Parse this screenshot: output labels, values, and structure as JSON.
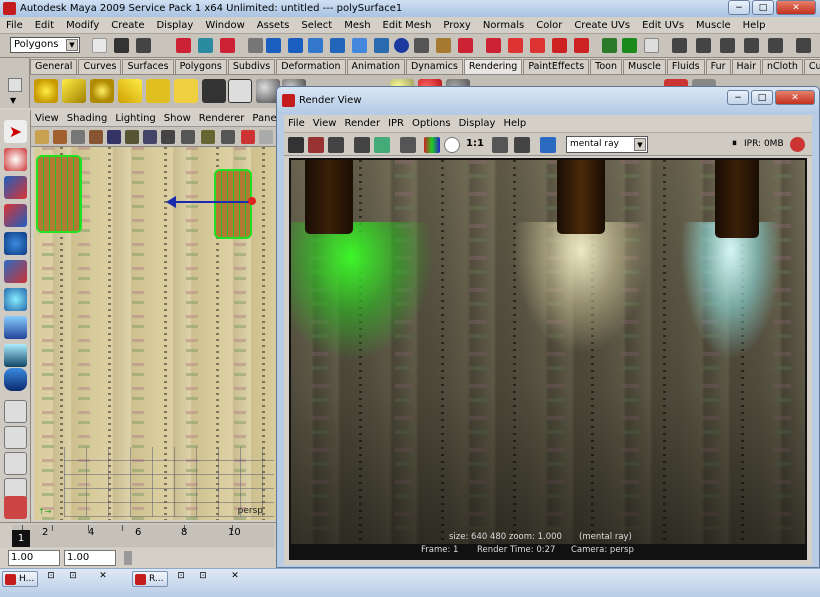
{
  "window": {
    "title": "Autodesk Maya 2009 Service Pack 1 x64 Unlimited: untitled   ---   polySurface1",
    "btn_min": "−",
    "btn_max": "□",
    "btn_close": "✕"
  },
  "menubar": [
    "File",
    "Edit",
    "Modify",
    "Create",
    "Display",
    "Window",
    "Assets",
    "Select",
    "Mesh",
    "Edit Mesh",
    "Proxy",
    "Normals",
    "Color",
    "Create UVs",
    "Edit UVs",
    "Muscle",
    "Help"
  ],
  "statusline": {
    "menu_set": "Polygons"
  },
  "shelf_tabs": [
    "General",
    "Curves",
    "Surfaces",
    "Polygons",
    "Subdivs",
    "Deformation",
    "Animation",
    "Dynamics",
    "Rendering",
    "PaintEffects",
    "Toon",
    "Muscle",
    "Fluids",
    "Fur",
    "Hair",
    "nCloth",
    "Custom"
  ],
  "shelf_active": "Rendering",
  "viewport": {
    "menu": [
      "View",
      "Shading",
      "Lighting",
      "Show",
      "Renderer",
      "Panels"
    ],
    "camera_label": "persp"
  },
  "timeline": {
    "ticks": [
      "2",
      "4",
      "6",
      "8",
      "10"
    ],
    "current_frame": "1",
    "start": "1.00",
    "end": "1.00"
  },
  "render_view": {
    "title": "Render View",
    "menu": [
      "File",
      "View",
      "Render",
      "IPR",
      "Options",
      "Display",
      "Help"
    ],
    "ratio_label": "1:1",
    "renderer": "mental ray",
    "ipr_status": "IPR: 0MB",
    "info": {
      "size": "size:  640  480 zoom: 1.000",
      "renderer": "(mental ray)",
      "frame": "Frame: 1",
      "render_time": "Render Time: 0:27",
      "camera": "Camera: persp"
    }
  },
  "taskbar": {
    "tasks": [
      {
        "label": "H..."
      },
      {
        "label": "R..."
      }
    ]
  },
  "colors": {
    "accent_red": "#c41c1c",
    "light_green": "#2ee02e",
    "light_yellow": "#fff6c0",
    "light_cyan": "#c8ffff"
  }
}
